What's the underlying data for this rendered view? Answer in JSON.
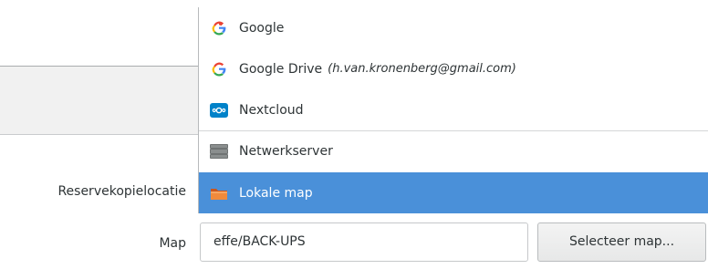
{
  "colors": {
    "selection": "#4a90d9",
    "nextcloud_blue": "#0082c9",
    "folder_orange": "#e8722c"
  },
  "dropdown": {
    "items": [
      {
        "icon": "google-icon",
        "label": "Google",
        "account": ""
      },
      {
        "icon": "google-icon",
        "label": "Google Drive",
        "account": "(h.van.kronenberg@gmail.com)"
      },
      {
        "icon": "nextcloud-icon",
        "label": "Nextcloud",
        "account": ""
      },
      {
        "icon": "network-server-icon",
        "label": "Netwerkserver",
        "account": ""
      },
      {
        "icon": "folder-icon",
        "label": "Lokale map",
        "account": "",
        "selected": true
      }
    ]
  },
  "form": {
    "location_label": "Reservekopielocatie",
    "folder_label": "Map",
    "folder_value": "effe/BACK-UPS",
    "select_folder_button": "Selecteer map..."
  }
}
